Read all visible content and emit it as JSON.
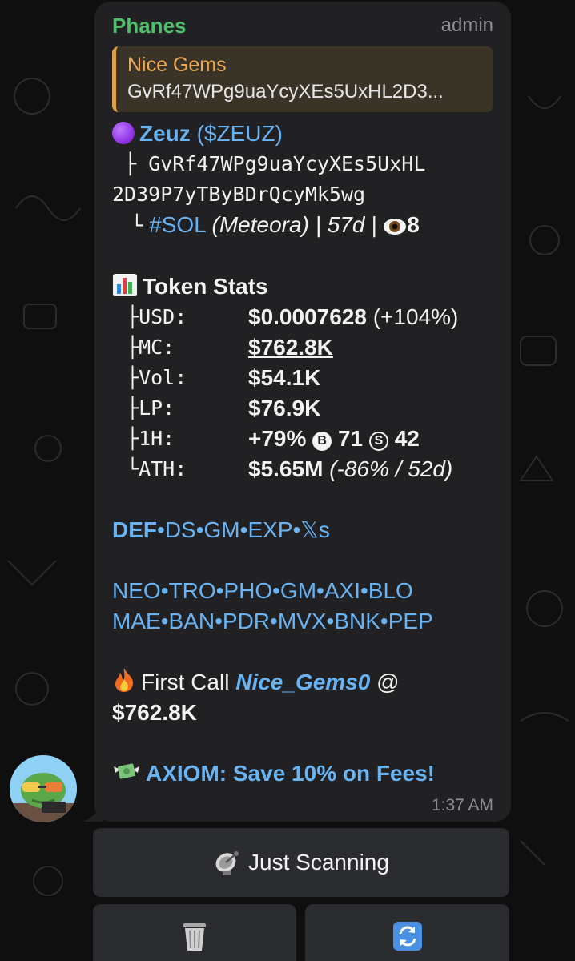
{
  "message": {
    "sender": "Phanes",
    "role": "admin",
    "reply": {
      "title": "Nice Gems",
      "text": "GvRf47WPg9uaYcyXEs5UxHL2D3..."
    },
    "token": {
      "name": "Zeuz",
      "ticker": "($ZEUZ)",
      "address_line1": "GvRf47WPg9uaYcyXEs5UxHL",
      "address_line2": "2D39P7yTByBDrQcyMk5wg",
      "branch1": "├",
      "branch2": "└",
      "chain": "#SOL",
      "dex": "(Meteora)",
      "age": "| 57d |",
      "views": "8"
    },
    "stats": {
      "title": "Token Stats",
      "rows": [
        {
          "branch": "├",
          "key": "USD:",
          "value": "$0.0007628",
          "extra": "(+104%)"
        },
        {
          "branch": "├",
          "key": "MC:",
          "value": "$762.8K"
        },
        {
          "branch": "├",
          "key": "Vol:",
          "value": "$54.1K"
        },
        {
          "branch": "├",
          "key": "LP:",
          "value": "$76.9K"
        },
        {
          "branch": "├",
          "key": "1H:",
          "value": "+79%",
          "b_label": "B",
          "b_count": "71",
          "s_label": "S",
          "s_count": "42"
        },
        {
          "branch": "└",
          "key": "ATH:",
          "value": "$5.65M",
          "extra": "(-86% / 52d)"
        }
      ]
    },
    "links1": [
      "DEF",
      "DS",
      "GM",
      "EXP",
      "𝕏s"
    ],
    "links2": [
      "NEO",
      "TRO",
      "PHO",
      "GM",
      "AXI",
      "BLO"
    ],
    "links3": [
      "MAE",
      "BAN",
      "PDR",
      "MVX",
      "BNK",
      "PEP"
    ],
    "separator": "•",
    "first_call": {
      "prefix": "First Call",
      "caller": "Nice_Gems0",
      "at": "@",
      "value": "$762.8K"
    },
    "promo": "AXIOM: Save 10% on Fees!",
    "time": "1:37 AM"
  },
  "buttons": {
    "scan": "Just Scanning",
    "trash_icon": "wastebasket-icon",
    "refresh_icon": "refresh-icon"
  },
  "colors": {
    "bubble": "#212123",
    "sender": "#4fc06a",
    "link": "#6ab3f3",
    "reply_accent": "#e0a04a"
  }
}
